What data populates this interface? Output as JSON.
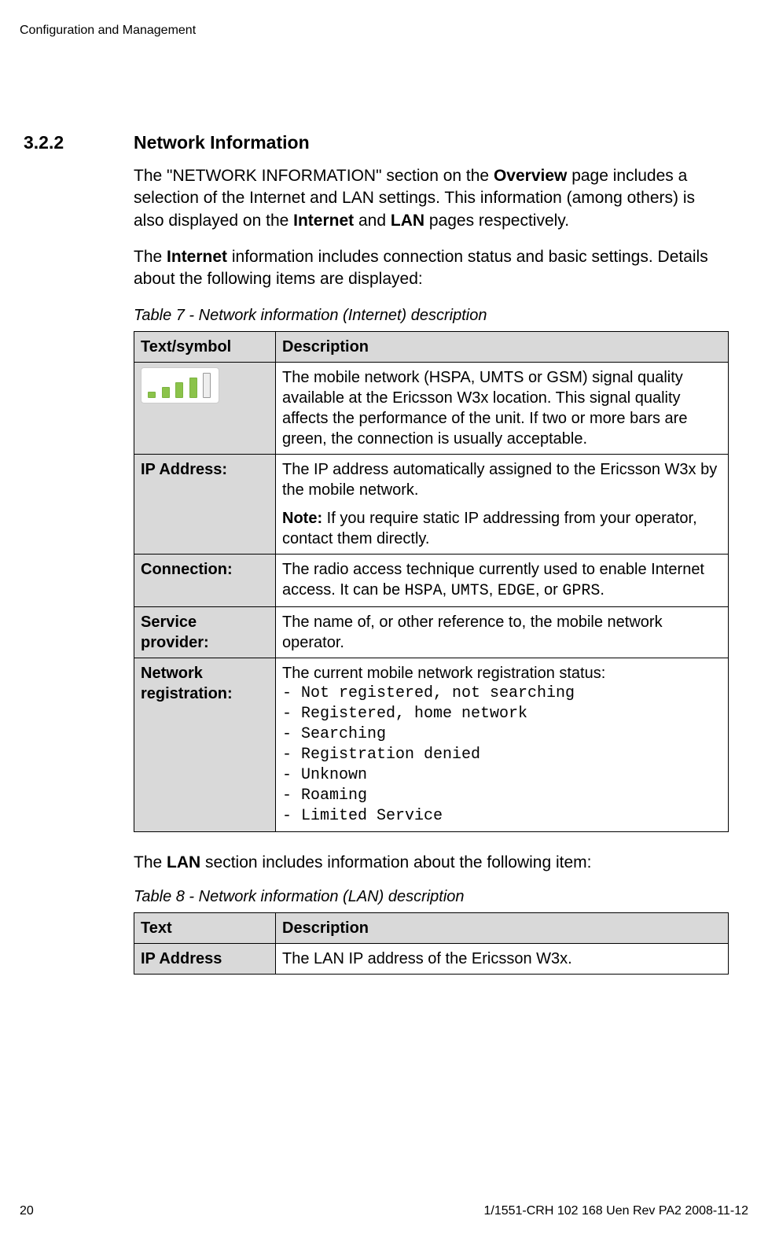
{
  "header": {
    "running_title": "Configuration and Management"
  },
  "section": {
    "number": "3.2.2",
    "title": "Network Information",
    "para1_pre": "The \"NETWORK INFORMATION\" section on the ",
    "para1_bold1": "Overview",
    "para1_mid": " page includes a selection of the Internet and LAN settings. This information (among others) is also displayed on the ",
    "para1_bold2": "Internet",
    "para1_and": " and ",
    "para1_bold3": "LAN",
    "para1_end": " pages respectively.",
    "para2_pre": "The ",
    "para2_bold": "Internet",
    "para2_end": " information includes connection status and basic settings. Details about the following items are displayed:"
  },
  "table7": {
    "caption": "Table 7 - Network information (Internet) description",
    "header_col1": "Text/symbol",
    "header_col2": "Description",
    "rows": {
      "signal": {
        "desc": "The mobile network (HSPA, UMTS or GSM) signal quality available at the Ericsson W3x location. This signal quality affects the performance of the unit. If two or more bars are green, the connection is usually acceptable."
      },
      "ip": {
        "label": "IP Address:",
        "desc": "The IP address automatically assigned to the Ericsson W3x by the mobile network.",
        "note_prefix": "Note:",
        "note_text": " If you require static IP addressing from your operator, contact them directly."
      },
      "connection": {
        "label": "Connection:",
        "desc_pre": "The radio access technique currently used to enable Internet access. It can be ",
        "m1": "HSPA",
        "c1": ",  ",
        "m2": "UMTS",
        "c2": ", ",
        "m3": "EDGE",
        "c3": ",  or ",
        "m4": "GPRS",
        "c4": "."
      },
      "service": {
        "label": "Service provider:",
        "desc": "The name of, or other reference to, the mobile network operator."
      },
      "netreg": {
        "label": "Network registration:",
        "desc_intro": "The current mobile network registration status:",
        "s1": "- Not registered, not searching",
        "s2": "- Registered, home network",
        "s3": "- Searching",
        "s4": "- Registration denied",
        "s5": "- Unknown",
        "s6": "- Roaming",
        "s7": "- Limited Service"
      }
    }
  },
  "para_lan_pre": "The ",
  "para_lan_bold": "LAN",
  "para_lan_end": " section includes information about the following item:",
  "table8": {
    "caption": "Table 8 - Network information (LAN) description",
    "header_col1": "Text",
    "header_col2": "Description",
    "row1": {
      "label": "IP Address",
      "desc": "The LAN IP address of the Ericsson W3x."
    }
  },
  "footer": {
    "page_number": "20",
    "doc_id": "1/1551-CRH 102 168 Uen Rev PA2  2008-11-12"
  }
}
